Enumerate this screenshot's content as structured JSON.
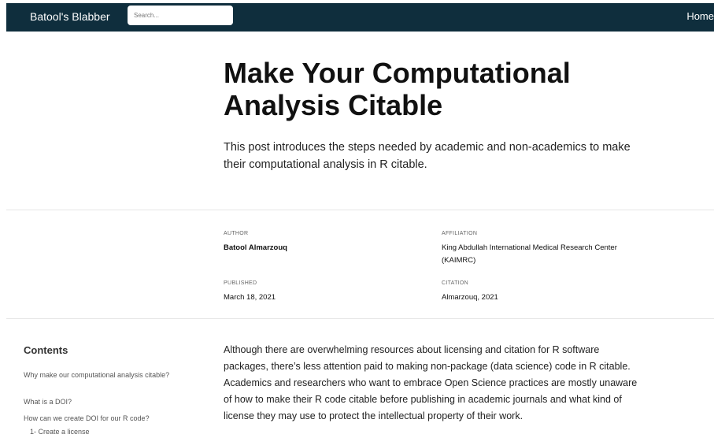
{
  "navbar": {
    "brand": "Batool's Blabber",
    "search_placeholder": "Search...",
    "home": "Home"
  },
  "article": {
    "title": "Make Your Computational Analysis Citable",
    "description": "This post introduces the steps needed by academic and non-academics to make their computational analysis in R citable."
  },
  "meta": {
    "author_label": "AUTHOR",
    "author": "Batool Almarzouq",
    "affiliation_label": "AFFILIATION",
    "affiliation": "King Abdullah International Medical Research Center (KAIMRC)",
    "published_label": "PUBLISHED",
    "published": "March 18, 2021",
    "citation_label": "CITATION",
    "citation": "Almarzouq, 2021"
  },
  "toc": {
    "title": "Contents",
    "items": [
      "Why make our computational analysis citable?",
      "What is a DOI?",
      "How can we create DOI for our R code?",
      "1- Create a license"
    ]
  },
  "body": {
    "paragraph": "Although there are overwhelming resources about licensing and citation for R software packages, there’s less attention paid to making non-package (data science) code in R citable. Academics and researchers who want to embrace Open Science practices are mostly unaware of how to make their R code citable before publishing in academic journals and what kind of license they may use to protect the intellectual property of their work."
  }
}
